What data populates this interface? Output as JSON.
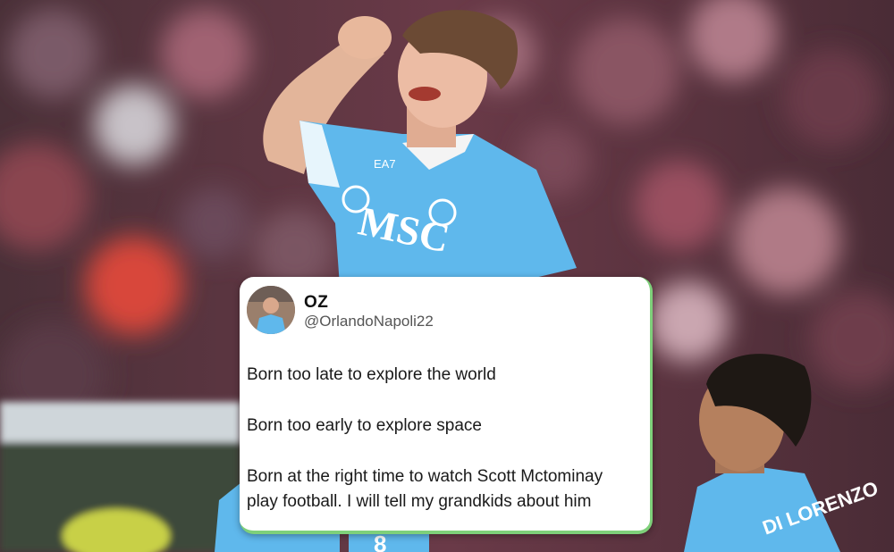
{
  "tweet": {
    "display_name": "OZ",
    "handle": "@OrlandoNapoli22",
    "lines": [
      "Born too late to explore the world",
      "Born too early to explore space",
      "Born at the right time to watch Scott Mctominay",
      "play football. I will tell my grandkids about him"
    ]
  },
  "photo": {
    "sponsor": "MSC",
    "kit_brand": "EA7",
    "back_name": "DI LORENZO",
    "back_number": "8"
  },
  "colors": {
    "jersey": "#5fb8ec",
    "card_border": "#7ed07a",
    "crowd": "#5a2c38"
  }
}
